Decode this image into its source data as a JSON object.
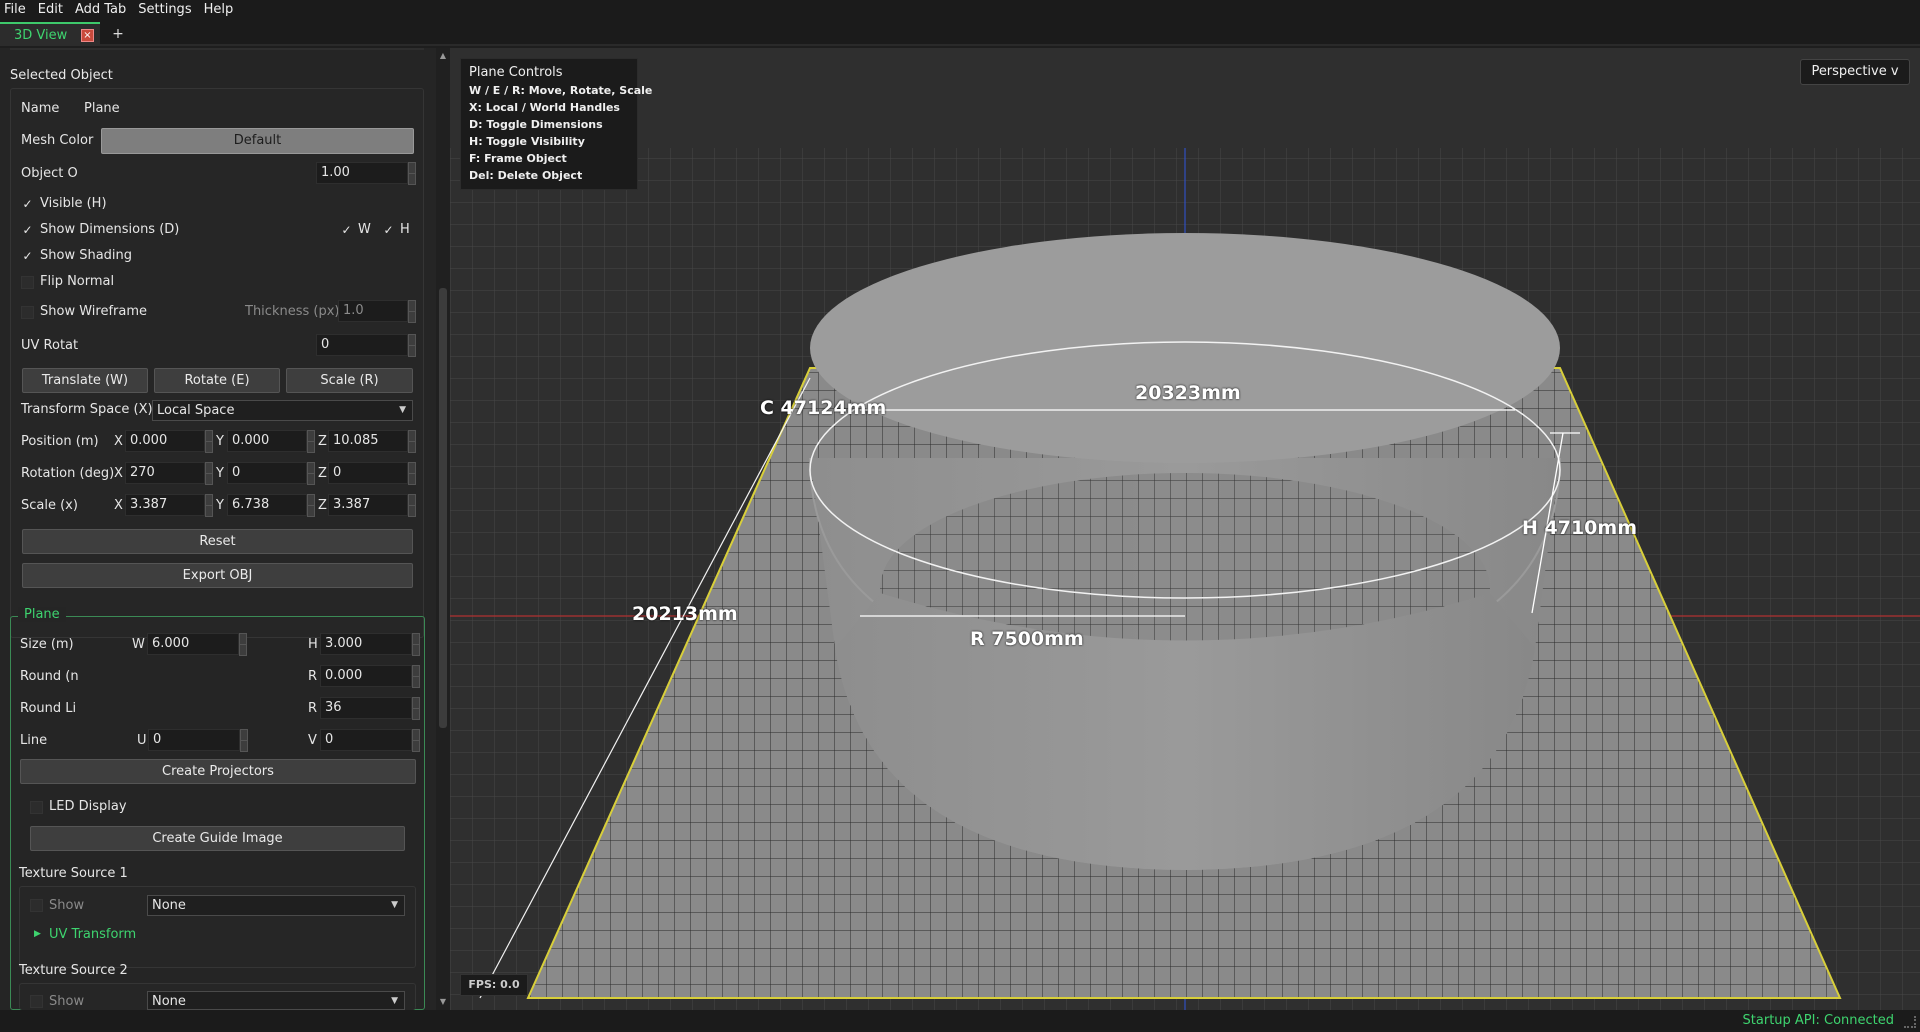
{
  "menu": [
    "File",
    "Edit",
    "Add Tab",
    "Settings",
    "Help"
  ],
  "tabs": {
    "active": "3D View",
    "close_icon": "×",
    "add": "+"
  },
  "selected_object": {
    "title": "Selected Object",
    "name_label": "Name",
    "name_value": "Plane",
    "mesh_color_label": "Mesh Color",
    "mesh_color_value": "Default",
    "opacity_label": "Object O",
    "opacity_value": "1.00",
    "visible_label": "Visible (H)",
    "show_dims_label": "Show Dimensions (D)",
    "w_label": "W",
    "h_label": "H",
    "show_shading_label": "Show Shading",
    "flip_normal_label": "Flip Normal",
    "show_wireframe_label": "Show Wireframe",
    "thickness_label": "Thickness (px)",
    "thickness_value": "1.0",
    "uv_rot_label": "UV Rotat",
    "uv_rot_value": "0",
    "translate_btn": "Translate (W)",
    "rotate_btn": "Rotate (E)",
    "scale_btn": "Scale (R)",
    "transform_space_label": "Transform Space (X)",
    "transform_space_value": "Local Space",
    "position_label": "Position (m)",
    "pos_x": "0.000",
    "pos_y": "0.000",
    "pos_z": "10.085",
    "rotation_label": "Rotation (deg)",
    "rot_x": "270",
    "rot_y": "0",
    "rot_z": "0",
    "scale_label": "Scale (x)",
    "scale_x": "3.387",
    "scale_y": "6.738",
    "scale_z": "3.387",
    "axis_x": "X",
    "axis_y": "Y",
    "axis_z": "Z",
    "reset_btn": "Reset",
    "export_btn": "Export OBJ"
  },
  "plane": {
    "title": "Plane",
    "size_label": "Size (m)",
    "w_label": "W",
    "w_value": "6.000",
    "h_label": "H",
    "h_value": "3.000",
    "round_n_label": "Round (n",
    "r_label": "R",
    "round_n_value": "0.000",
    "round_li_label": "Round Li",
    "round_li_value": "36",
    "line_label": "Line",
    "u_label": "U",
    "u_value": "0",
    "v_label": "V",
    "v_value": "0",
    "create_projectors_btn": "Create Projectors",
    "led_display_label": "LED Display",
    "create_guide_btn": "Create Guide Image",
    "tex1_title": "Texture Source 1",
    "tex1_show": "Show",
    "tex1_value": "None",
    "uv_transform": "UV Transform",
    "tex2_title": "Texture Source 2",
    "tex2_show": "Show",
    "tex2_value": "None"
  },
  "viewport": {
    "controls_title": "Plane Controls",
    "controls": [
      "W / E / R: Move, Rotate, Scale",
      "X: Local / World Handles",
      "D: Toggle Dimensions",
      "H: Toggle Visibility",
      "F: Frame Object",
      "Del: Delete Object"
    ],
    "projection": "Perspective v",
    "fps": "FPS: 0.0",
    "dims": {
      "circumference": "C 47124mm",
      "diameter": "20323mm",
      "height": "H 4710mm",
      "radius": "R 7500mm",
      "slant": "20213mm"
    }
  },
  "status": "Startup API: Connected",
  "colors": {
    "accent_green": "#3ed46f",
    "floor_edge": "#d8cf3a",
    "axis_red": "#b03030",
    "axis_blue": "#3050c0"
  }
}
